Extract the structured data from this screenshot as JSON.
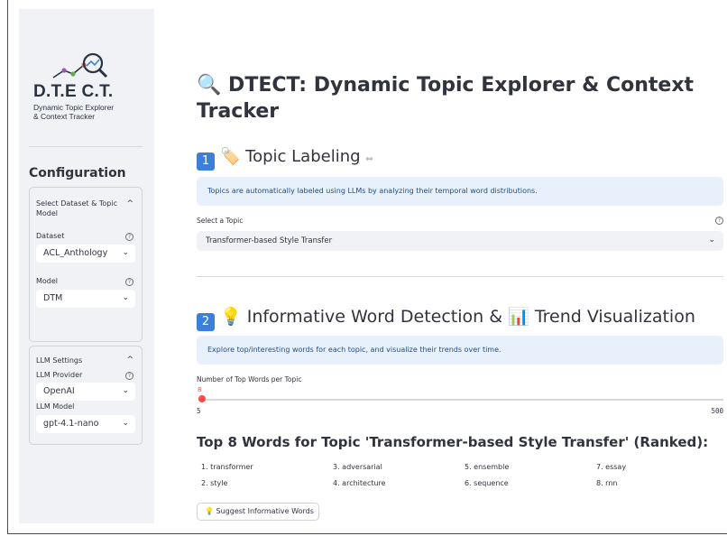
{
  "sidebar": {
    "logo_title": "D.T.E C.T.",
    "logo_subtitle_1": "Dynamic Topic Explorer",
    "logo_subtitle_2": "& Context Tracker",
    "config_title": "Configuration",
    "dataset_panel": {
      "header_1": "Select Dataset & Topic",
      "header_2": "Model",
      "dataset_label": "Dataset",
      "dataset_value": "ACL_Anthology",
      "model_label": "Model",
      "model_value": "DTM"
    },
    "llm_panel": {
      "header": "LLM Settings",
      "provider_label": "LLM Provider",
      "provider_value": "OpenAI",
      "model_label": "LLM Model",
      "model_value": "gpt-4.1-nano"
    },
    "help_glyph": "?",
    "caret_up": "^",
    "caret_down": "⌄"
  },
  "main": {
    "title_line1": "🔍 DTECT: Dynamic Topic Explorer & Context",
    "title_line2": "Tracker",
    "section1": {
      "badge": "1",
      "emoji": "🏷️",
      "title": "Topic Labeling",
      "link_icon": "⇔",
      "info": "Topics are automatically labeled using LLMs by analyzing their temporal word distributions.",
      "select_label": "Select a Topic",
      "select_value": "Transformer-based Style Transfer"
    },
    "section2": {
      "badge": "2",
      "emoji1": "💡",
      "title_part1": "Informative Word Detection &",
      "emoji2": "📊",
      "title_part2": "Trend Visualization",
      "info": "Explore top/interesting words for each topic, and visualize their trends over time.",
      "slider_label": "Number of Top Words per Topic",
      "slider_value": "8",
      "slider_fraction": 0.006,
      "slider_min": "5",
      "slider_max": "500"
    },
    "words_title": "Top 8 Words for Topic 'Transformer-based Style Transfer' (Ranked):",
    "words": [
      "1. transformer",
      "3. adversarial",
      "5. ensemble",
      "7. essay",
      "2. style",
      "4. architecture",
      "6. sequence",
      "8. rnn"
    ],
    "suggest_button": "Suggest Informative Words",
    "suggest_emoji": "💡"
  }
}
